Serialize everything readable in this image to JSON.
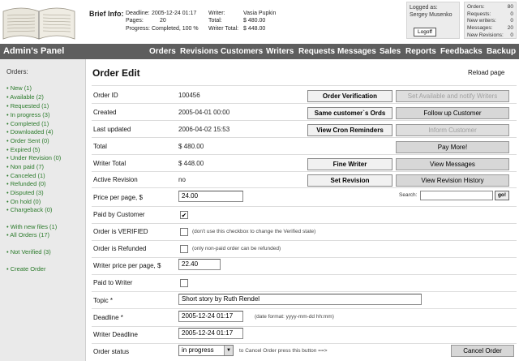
{
  "header": {
    "brief_label": "Brief Info:",
    "deadline_label": "Deadline:",
    "deadline_value": "2005-12-24 01:17",
    "pages_label": "Pages:",
    "pages_value": "20",
    "progress_label": "Progress:",
    "progress_value": "Completed, 100 %",
    "writer_label": "Writer:",
    "writer_value": "Vasia Pupkin",
    "total_label": "Total:",
    "total_value": "$ 480.00",
    "writer_total_label": "Writer Total:",
    "writer_total_value": "$ 448.00"
  },
  "login": {
    "logged_as": "Logged as:",
    "user": "Sergey Musenko",
    "logout": "Logoff"
  },
  "stats": [
    {
      "label": "Orders:",
      "value": "80"
    },
    {
      "label": "Requests:",
      "value": "0"
    },
    {
      "label": "New writers:",
      "value": "0"
    },
    {
      "label": "Messages:",
      "value": "20"
    },
    {
      "label": "New Revisions:",
      "value": "0"
    }
  ],
  "nav": {
    "title": "Admin's Panel",
    "items": [
      "Orders",
      "Revisions",
      "Customers",
      "Writers",
      "Requests",
      "Messages",
      "Sales",
      "Reports",
      "Feedbacks",
      "Backup"
    ]
  },
  "sidebar": {
    "heading": "Orders:",
    "items": [
      "• New (1)",
      "• Available (2)",
      "• Requested (1)",
      "• In progress (3)",
      "• Completed (1)",
      "• Downloaded (4)",
      "• Order Sent (0)",
      "• Expired (5)",
      "• Under Revision (0)",
      "• Non paid (7)",
      "• Canceled (1)",
      "• Refunded (0)",
      "• Disputed (3)",
      "• On hold (0)",
      "• Chargeback (0)",
      "• With new files (1)",
      "• All Orders (17)",
      "• Not Verified (3)",
      "• Create Order"
    ]
  },
  "main": {
    "title": "Order Edit",
    "reload": "Reload page",
    "rows": [
      {
        "label": "Order ID",
        "value": "100456"
      },
      {
        "label": "Created",
        "value": "2005-04-01 00:00"
      },
      {
        "label": "Last updated",
        "value": "2006-04-02 15:53"
      },
      {
        "label": "Total",
        "value": "$ 480.00"
      },
      {
        "label": "Writer Total",
        "value": "$ 448.00"
      },
      {
        "label": "Active Revision",
        "value": "no"
      }
    ],
    "price_label": "Price per page, $",
    "price_value": "24.00",
    "paid_label": "Paid by Customer",
    "paid_checked": "✔",
    "verified_label": "Order is VERIFIED",
    "verified_note": "(don't use this checkbox to change the Verified state)",
    "refunded_label": "Order is Refunded",
    "refunded_note": "(only non-paid order can be refunded)",
    "writer_price_label": "Writer price per page, $",
    "writer_price_value": "22.40",
    "paid_writer_label": "Paid to Writer",
    "topic_label": "Topic *",
    "topic_value": "Short story by Ruth Rendel",
    "deadline_label": "Deadline *",
    "deadline_value": "2005-12-24 01:17",
    "deadline_note": "(date format: yyyy-mm-dd hh:mm)",
    "writer_deadline_label": "Writer Deadline",
    "writer_deadline_value": "2005-12-24 01:17",
    "status_label": "Order status",
    "status_value": "in progress",
    "status_note": "to Cancel Order press this button ==>",
    "cancel_button": "Cancel Order"
  },
  "buttons": {
    "order_verification": "Order Verification",
    "same_customer": "Same customer`s Ords",
    "view_cron": "View Cron Reminders",
    "fine_writer": "Fine Writer",
    "set_revision": "Set Revision",
    "set_available": "Set Available and notify Writers",
    "follow_up": "Follow up Customer",
    "inform_customer": "Inform Customer",
    "pay_more": "Pay More!",
    "view_messages": "View Messages",
    "view_revision_history": "View Revision History",
    "search_label": "Search:",
    "go": "go!"
  }
}
